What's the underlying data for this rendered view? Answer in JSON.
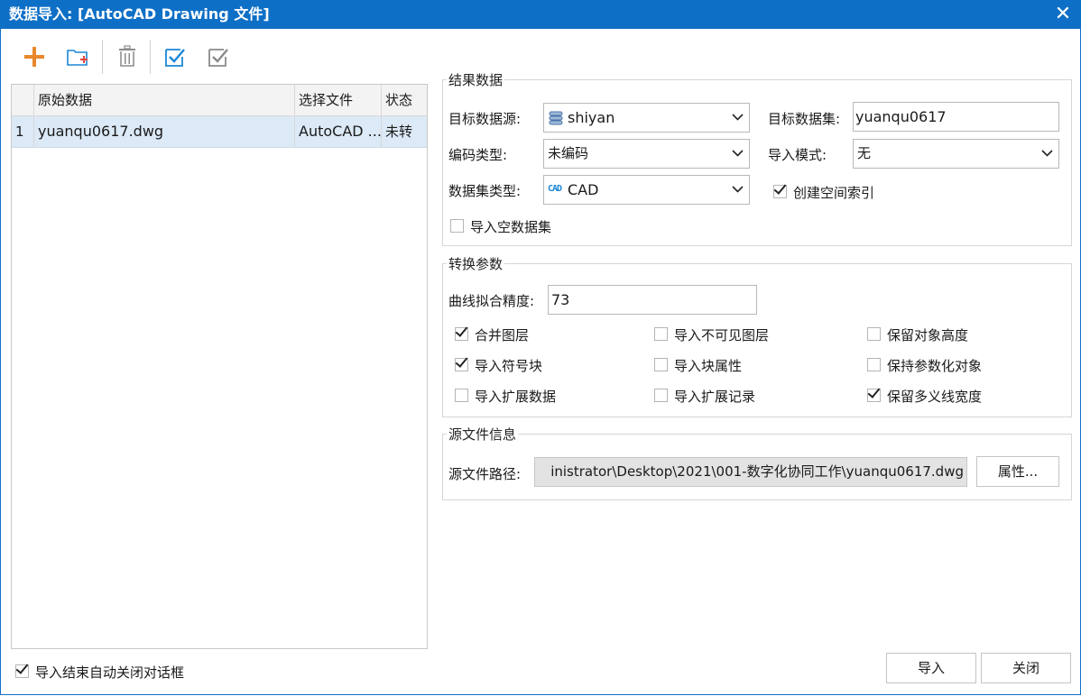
{
  "window": {
    "title": "数据导入: [AutoCAD Drawing 文件]",
    "close_glyph": "✕"
  },
  "toolbar": {
    "colors": {
      "add": "#e8882a",
      "accent": "#1b87d6",
      "gray": "#8a8a8a"
    }
  },
  "file_table": {
    "columns": [
      "原始数据",
      "选择文件",
      "状态"
    ],
    "rows": [
      {
        "index": "1",
        "source": "yuanqu0617.dwg",
        "file": "AutoCAD ...",
        "status": "未转"
      }
    ]
  },
  "result": {
    "legend": "结果数据",
    "target_source_label": "目标数据源:",
    "target_source_value": "shiyan",
    "target_dataset_label": "目标数据集:",
    "target_dataset_value": "yuanqu0617",
    "encoding_label": "编码类型:",
    "encoding_value": "未编码",
    "import_mode_label": "导入模式:",
    "import_mode_value": "无",
    "dataset_type_label": "数据集类型:",
    "dataset_type_value": "CAD",
    "dataset_type_icon_text": "CAD",
    "spatial_index_label": "创建空间索引",
    "spatial_index_checked": true,
    "import_empty_label": "导入空数据集",
    "import_empty_checked": false
  },
  "convert": {
    "legend": "转换参数",
    "curve_label": "曲线拟合精度:",
    "curve_value": "73",
    "options": [
      {
        "label": "合并图层",
        "checked": true
      },
      {
        "label": "导入不可见图层",
        "checked": false
      },
      {
        "label": "保留对象高度",
        "checked": false
      },
      {
        "label": "导入符号块",
        "checked": true
      },
      {
        "label": "导入块属性",
        "checked": false
      },
      {
        "label": "保持参数化对象",
        "checked": false
      },
      {
        "label": "导入扩展数据",
        "checked": false
      },
      {
        "label": "导入扩展记录",
        "checked": false
      },
      {
        "label": "保留多义线宽度",
        "checked": true
      }
    ]
  },
  "source_info": {
    "legend": "源文件信息",
    "path_label": "源文件路径:",
    "path_value": "inistrator\\Desktop\\2021\\001-数字化协同工作\\yuanqu0617.dwg",
    "properties_button": "属性..."
  },
  "footer": {
    "auto_close_label": "导入结束自动关闭对话框",
    "auto_close_checked": true,
    "import_button": "导入",
    "close_button": "关闭"
  }
}
